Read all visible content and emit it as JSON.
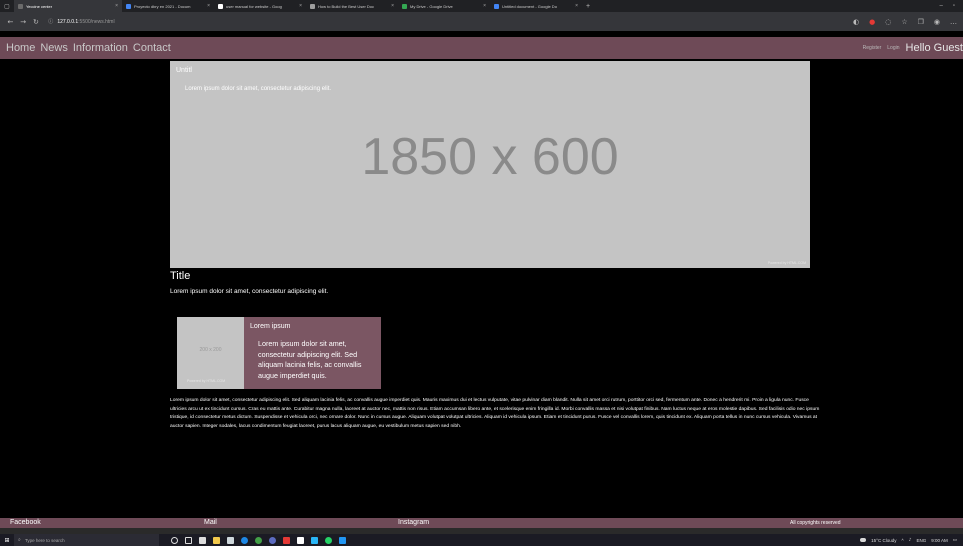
{
  "browser": {
    "tabs": [
      {
        "title": "Yeccine center",
        "color": "#6b6b6b",
        "active": true
      },
      {
        "title": "Proyecto dbry en 2021 - Docum",
        "color": "#4285f4",
        "active": false
      },
      {
        "title": "user manual for website - Goog",
        "color": "#ffffff",
        "active": false
      },
      {
        "title": "How to Build the Best User Doc",
        "color": "#9e9e9e",
        "active": false
      },
      {
        "title": "My Drive - Google Drive",
        "color": "#34a853",
        "active": false
      },
      {
        "title": "Untitled document - Google Do",
        "color": "#4285f4",
        "active": false
      }
    ],
    "url_host": "127.0.0.1",
    "url_rest": ":5500/news.html"
  },
  "nav": {
    "links": [
      "Home",
      "News",
      "Information",
      "Contact"
    ],
    "register": "Register",
    "login": "Login",
    "hello": "Hello Guest"
  },
  "hero": {
    "caption_title": "Untitl",
    "caption_text": "Lorem ipsum dolor sit amet, consectetur adipiscing elit.",
    "placeholder_dims": "1850 x 600",
    "powered": "Powered by HTML.COM"
  },
  "article": {
    "title": "Title",
    "lead": "Lorem ipsum dolor sit amet, consectetur adipiscing elit.",
    "body": "Lorem ipsum dolor sit amet, consectetur adipiscing elit. Sed aliquam lacinia felis, ac convallis augue imperdiet quis. Mauris maximus dui et lectus vulputate, vitae pulvinar diam blandit. Nulla sit amet orci rutrum, porttitor orci sed, fermentum ante. Donec a hendrerit mi. Proin a ligula nunc. Fusce ultricies arcu ut ex tincidunt cursus. Cras eu mattis ante. Curabitur magna nulla, laoreet at auctor nec, mattis non risus. Etiam accumsan libero ante, et scelerisque enim fringilla id. Morbi convallis massa et nisi volutpat finibus. Nam luctus neque at eros molestie dapibus. Sed facilisis odio nec ipsum tristique, id consectetur metus dictum. Suspendisse et vehicula orci, nec ornare dolor. Nunc in cursus augue. Aliquam volutpat volutpat ultricies. Aliquam id vehicula ipsum. Etiam et tincidunt purus. Fusce vel convallis lorem, quis tincidunt ex. Aliquam porta tellus in nunc cursus vehicula. Vivamus at auctor sapien. Integer sodales, lacus condimentum feugiat laoreet, purus lacus aliquam augue, eu vestibulum metus sapien sed nibh."
  },
  "card": {
    "thumb_dims": "200 x 200",
    "thumb_powered": "Powered by HTML.COM",
    "title": "Lorem ipsum",
    "text": "Lorem ipsum dolor sit amet, consectetur adipiscing elit. Sed aliquam lacinia felis, ac convallis augue imperdiet quis."
  },
  "footer": {
    "facebook": "Facebook",
    "mail": "Mail",
    "instagram": "Instagram",
    "copyright": "All copyrights reserved"
  },
  "taskbar": {
    "search_placeholder": "Type here to search",
    "weather": "15°C Cloudy",
    "language": "ENG",
    "time": "9:00 AM"
  },
  "colors": {
    "brand": "#6e4a57",
    "card": "#7b5663",
    "placeholder": "#c4c4c4"
  }
}
